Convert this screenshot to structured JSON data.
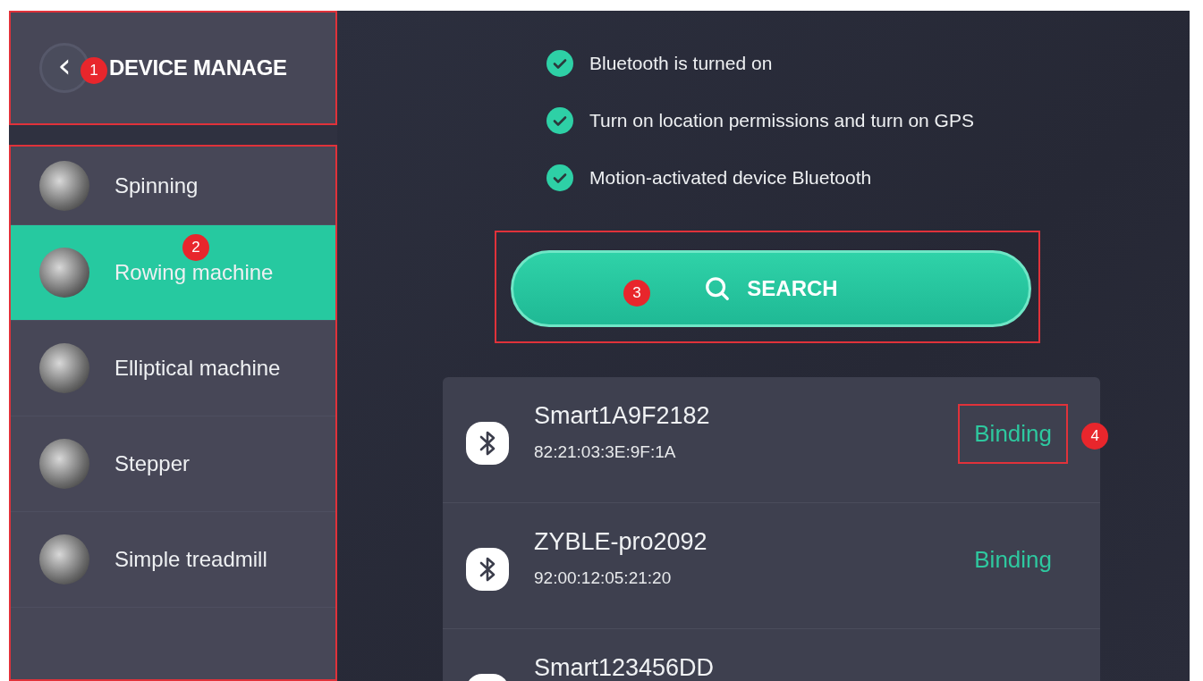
{
  "header": {
    "back_icon": "‹",
    "title": "DEVICE MANAGE",
    "callout": "1"
  },
  "sidebar": {
    "callout": "2",
    "items": [
      {
        "label": "Spinning",
        "selected": false
      },
      {
        "label": "Rowing machine",
        "selected": true
      },
      {
        "label": "Elliptical machine",
        "selected": false
      },
      {
        "label": "Stepper",
        "selected": false
      },
      {
        "label": "Simple treadmill",
        "selected": false
      }
    ]
  },
  "checklist": [
    {
      "text": "Bluetooth is turned on",
      "checked": true
    },
    {
      "text": "Turn on location permissions and turn on GPS",
      "checked": true
    },
    {
      "text": "Motion-activated device Bluetooth",
      "checked": true
    }
  ],
  "search_button": {
    "label": "SEARCH",
    "callout": "3"
  },
  "devices": [
    {
      "name": "Smart1A9F2182",
      "address": "82:21:03:3E:9F:1A",
      "action": "Binding",
      "callout": "4"
    },
    {
      "name": "ZYBLE-pro2092",
      "address": "92:00:12:05:21:20",
      "action": "Binding"
    },
    {
      "name": "Smart123456DD"
    }
  ]
}
